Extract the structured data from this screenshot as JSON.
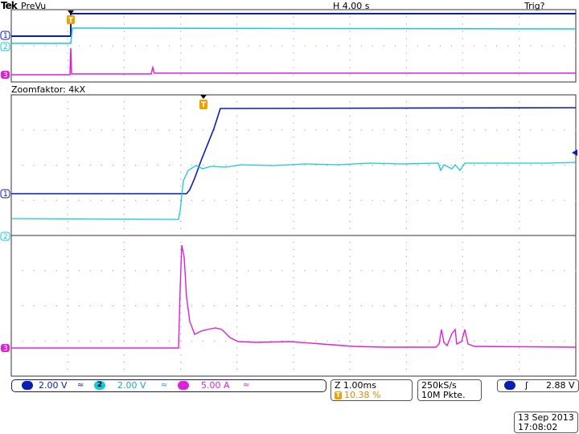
{
  "header": {
    "brand": "Tek",
    "mode": "PreVu",
    "horizontal": "H 4.00 s",
    "trigger_state": "Trig?"
  },
  "zoom": {
    "label": "Zoomfaktor: 4kX"
  },
  "channels": [
    {
      "id": "1",
      "scale": "2.00 V",
      "coupling": "≈",
      "color": "#0a1eb4"
    },
    {
      "id": "2",
      "scale": "2.00 V",
      "coupling": "≈",
      "color": "#18c8dc"
    },
    {
      "id": "3",
      "scale": "5.00 A",
      "coupling": "≈",
      "color": "#e020d8"
    }
  ],
  "zoom_settings": {
    "time": "Z 1.00ms",
    "trigger_pos": "10.38 %",
    "trigger_marker": "T"
  },
  "acquisition": {
    "rate": "250kS/s",
    "record": "10M Pkte."
  },
  "trigger": {
    "source": "1",
    "slope": "ʃ",
    "level": "2.88 V"
  },
  "datetime": {
    "date": "13 Sep  2013",
    "time": "17:08:02"
  },
  "markers": {
    "trigger_label": "T"
  },
  "colors": {
    "ch1": "#0a1eb4",
    "ch2": "#18c8dc",
    "ch3": "#e020d8",
    "trigger": "#f0a000",
    "grid": "#888888"
  }
}
